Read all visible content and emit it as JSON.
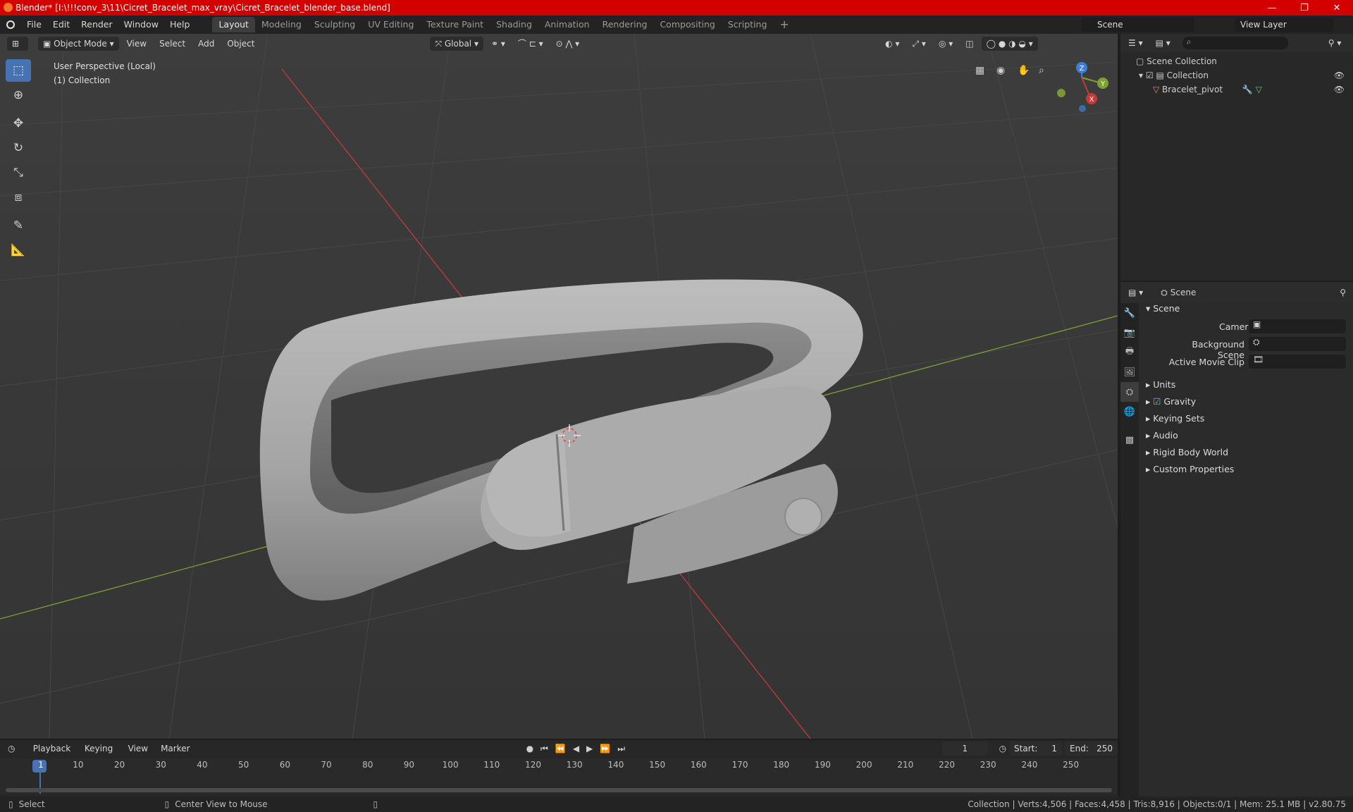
{
  "window": {
    "title": "Blender* [I:\\!!!conv_3\\11\\Cicret_Bracelet_max_vray\\Cicret_Bracelet_blender_base.blend]",
    "minimize": "—",
    "maximize": "❐",
    "close": "✕"
  },
  "menu": [
    "File",
    "Edit",
    "Render",
    "Window",
    "Help"
  ],
  "workspaces": [
    "Layout",
    "Modeling",
    "Sculpting",
    "UV Editing",
    "Texture Paint",
    "Shading",
    "Animation",
    "Rendering",
    "Compositing",
    "Scripting"
  ],
  "active_workspace": "Layout",
  "scene_selector": "Scene",
  "view_layer": "View Layer",
  "viewport": {
    "mode": "Object Mode",
    "menus": [
      "View",
      "Select",
      "Add",
      "Object"
    ],
    "orientation": "Global",
    "info_line1": "User Perspective (Local)",
    "info_line2": "(1) Collection",
    "gizmo": {
      "x": "X",
      "y": "Y",
      "z": "Z"
    }
  },
  "outliner": {
    "root": "Scene Collection",
    "collection": "Collection",
    "object": "Bracelet_pivot"
  },
  "properties": {
    "header": "Scene",
    "panel": "Scene",
    "camera_label": "Camera",
    "background_label": "Background Scene",
    "movie_clip_label": "Active Movie Clip",
    "sections": [
      "Units",
      "Gravity",
      "Keying Sets",
      "Audio",
      "Rigid Body World",
      "Custom Properties"
    ]
  },
  "timeline": {
    "menus": [
      "Playback",
      "Keying",
      "View",
      "Marker"
    ],
    "current_frame": "1",
    "start_label": "Start:",
    "start": "1",
    "end_label": "End:",
    "end": "250",
    "ticks": [
      "1",
      "10",
      "20",
      "30",
      "40",
      "50",
      "60",
      "70",
      "80",
      "90",
      "100",
      "110",
      "120",
      "130",
      "140",
      "150",
      "160",
      "170",
      "180",
      "190",
      "200",
      "210",
      "220",
      "230",
      "240",
      "250"
    ]
  },
  "status": {
    "left": "Select",
    "middle": "Center View to Mouse",
    "right": "Collection | Verts:4,506 | Faces:4,458 | Tris:8,916 | Objects:0/1 | Mem: 25.1 MB | v2.80.75"
  },
  "colors": {
    "accent": "#4772b3",
    "title_bar": "#d40000",
    "x_axis": "#c43a3a",
    "y_axis": "#7ea232",
    "z_axis": "#3d7fd6"
  }
}
